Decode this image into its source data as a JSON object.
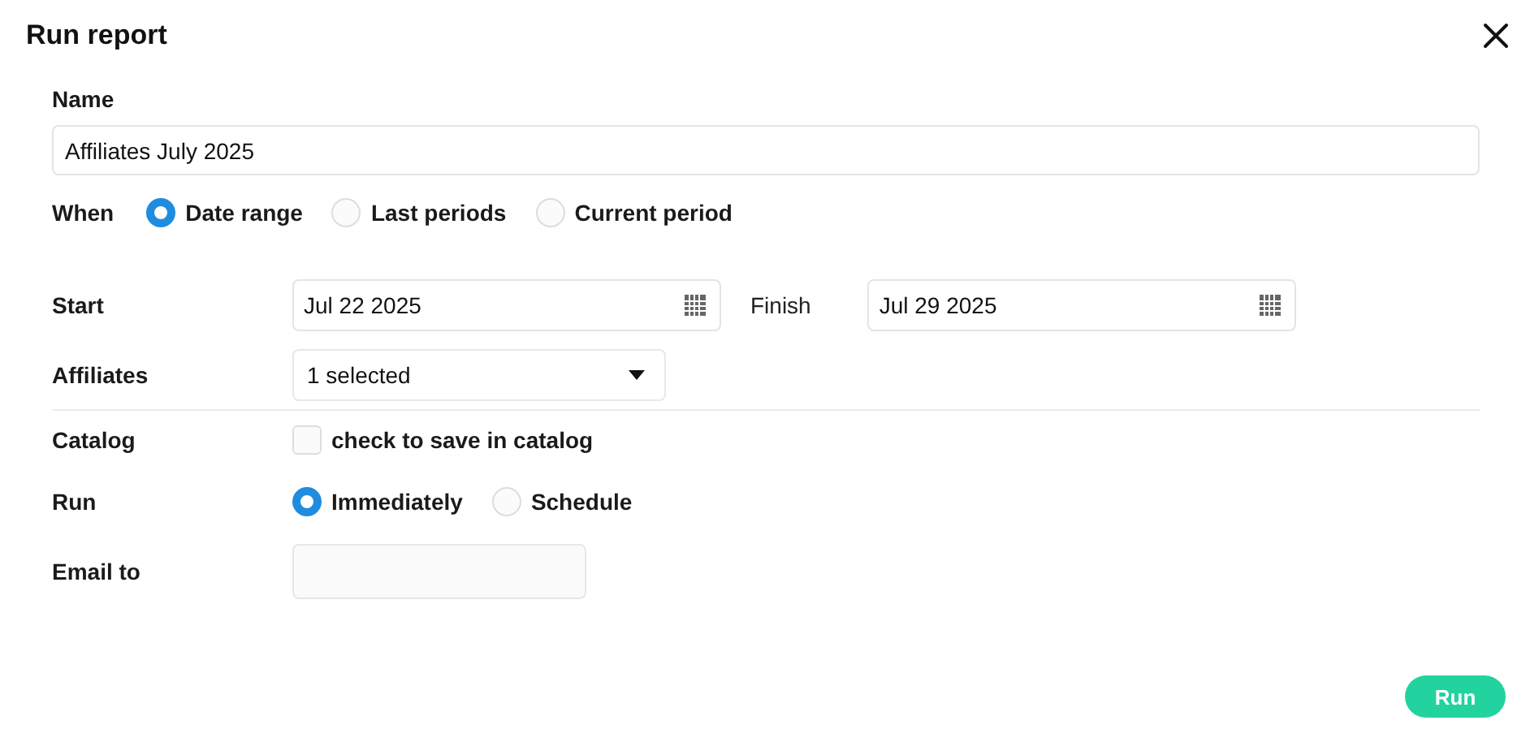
{
  "dialog": {
    "title": "Run report"
  },
  "name_field": {
    "label": "Name",
    "value": "Affiliates July 2025"
  },
  "when": {
    "label": "When",
    "options": [
      {
        "label": "Date range",
        "selected": true
      },
      {
        "label": "Last periods",
        "selected": false
      },
      {
        "label": "Current period",
        "selected": false
      }
    ]
  },
  "start": {
    "label": "Start",
    "value": "Jul 22 2025"
  },
  "finish": {
    "label": "Finish",
    "value": "Jul 29 2025"
  },
  "affiliates": {
    "label": "Affiliates",
    "value": "1 selected"
  },
  "catalog": {
    "label": "Catalog",
    "checkbox_label": "check to save in catalog",
    "checked": false
  },
  "run": {
    "label": "Run",
    "options": [
      {
        "label": "Immediately",
        "selected": true
      },
      {
        "label": "Schedule",
        "selected": false
      }
    ]
  },
  "email": {
    "label": "Email to"
  },
  "run_button": "Run"
}
